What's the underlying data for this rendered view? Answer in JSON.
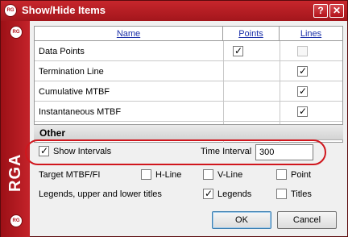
{
  "window": {
    "title": "Show/Hide Items",
    "logo_text": "RG",
    "brand_vertical": "RGA",
    "help_glyph": "?",
    "close_glyph": "✕",
    "accent_color": "#b3131a"
  },
  "grid": {
    "headers": [
      "Name",
      "Points",
      "Lines"
    ],
    "rows": [
      {
        "label": "Data Points",
        "points": "checked",
        "lines": "disabled"
      },
      {
        "label": "Termination Line",
        "points": "none",
        "lines": "checked"
      },
      {
        "label": "Cumulative MTBF",
        "points": "none",
        "lines": "checked"
      },
      {
        "label": "Instantaneous MTBF",
        "points": "none",
        "lines": "checked"
      }
    ]
  },
  "other": {
    "title": "Other",
    "show_intervals": {
      "label": "Show Intervals",
      "checked": true
    },
    "time_interval": {
      "label": "Time Interval",
      "value": "300"
    },
    "target_label": "Target MTBF/FI",
    "h_line": {
      "label": "H-Line",
      "checked": false
    },
    "v_line": {
      "label": "V-Line",
      "checked": false
    },
    "point": {
      "label": "Point",
      "checked": false
    },
    "legends_label": "Legends, upper and lower titles",
    "legends": {
      "label": "Legends",
      "checked": true
    },
    "titles": {
      "label": "Titles",
      "checked": false
    }
  },
  "buttons": {
    "ok": "OK",
    "cancel": "Cancel"
  }
}
